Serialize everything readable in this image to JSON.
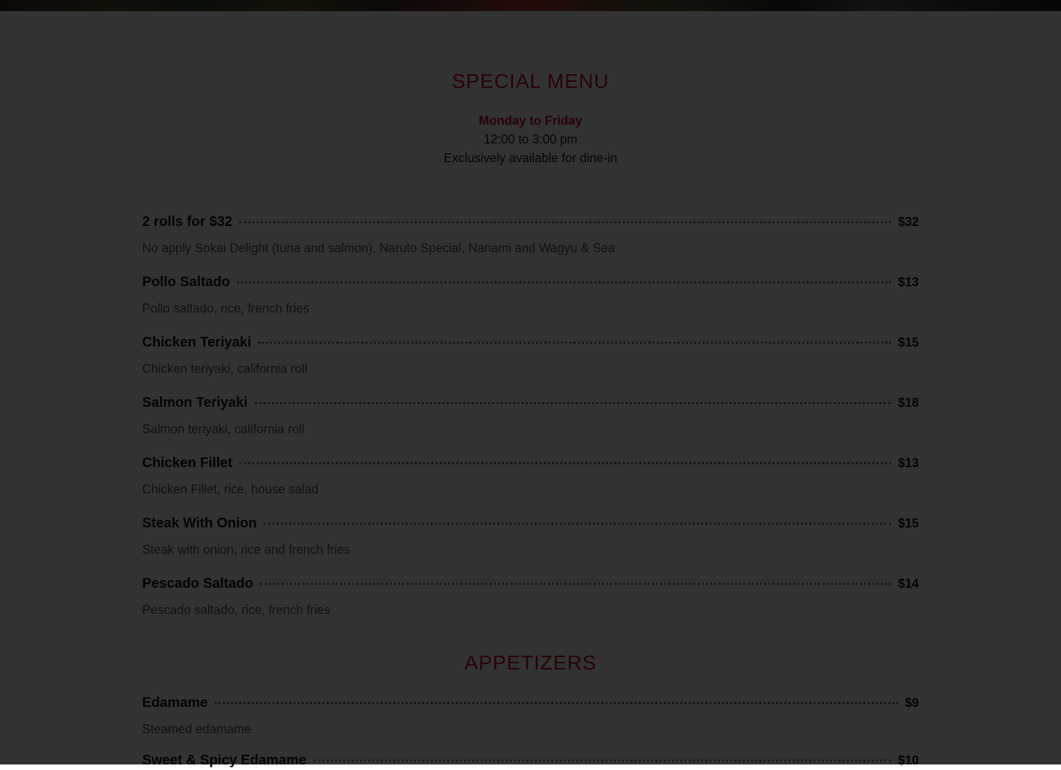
{
  "special": {
    "title": "SPECIAL MENU",
    "days": "Monday to Friday",
    "hours": "12:00 to 3:00 pm",
    "note": "Exclusively available for dine-in",
    "items": [
      {
        "name": "2 rolls for $32",
        "price": "$32",
        "desc": "No apply Sokai Delight (tuna and salmon), Naruto Special, Nanami and Wagyu & Sea"
      },
      {
        "name": "Pollo Saltado",
        "price": "$13",
        "desc": "Pollo saltado, rice, french fries"
      },
      {
        "name": "Chicken Teriyaki",
        "price": "$15",
        "desc": "Chicken teriyaki, california roll"
      },
      {
        "name": "Salmon Teriyaki",
        "price": "$18",
        "desc": "Salmon teriyaki, california roll"
      },
      {
        "name": "Chicken Fillet",
        "price": "$13",
        "desc": "Chicken Fillet, rice, house salad"
      },
      {
        "name": "Steak With Onion",
        "price": "$15",
        "desc": "Steak with onion, rice and french fries"
      },
      {
        "name": "Pescado Saltado",
        "price": "$14",
        "desc": "Pescado saltado, rice, french fries"
      }
    ]
  },
  "appetizers": {
    "title": "APPETIZERS",
    "items": [
      {
        "name": "Edamame",
        "price": "$9",
        "desc": "Steamed edamame"
      },
      {
        "name": "Sweet & Spicy Edamame",
        "price": "$10",
        "desc": ""
      }
    ]
  },
  "colors": {
    "accent": "#d10d23",
    "overlay": "rgba(0,0,0,0.80)"
  }
}
